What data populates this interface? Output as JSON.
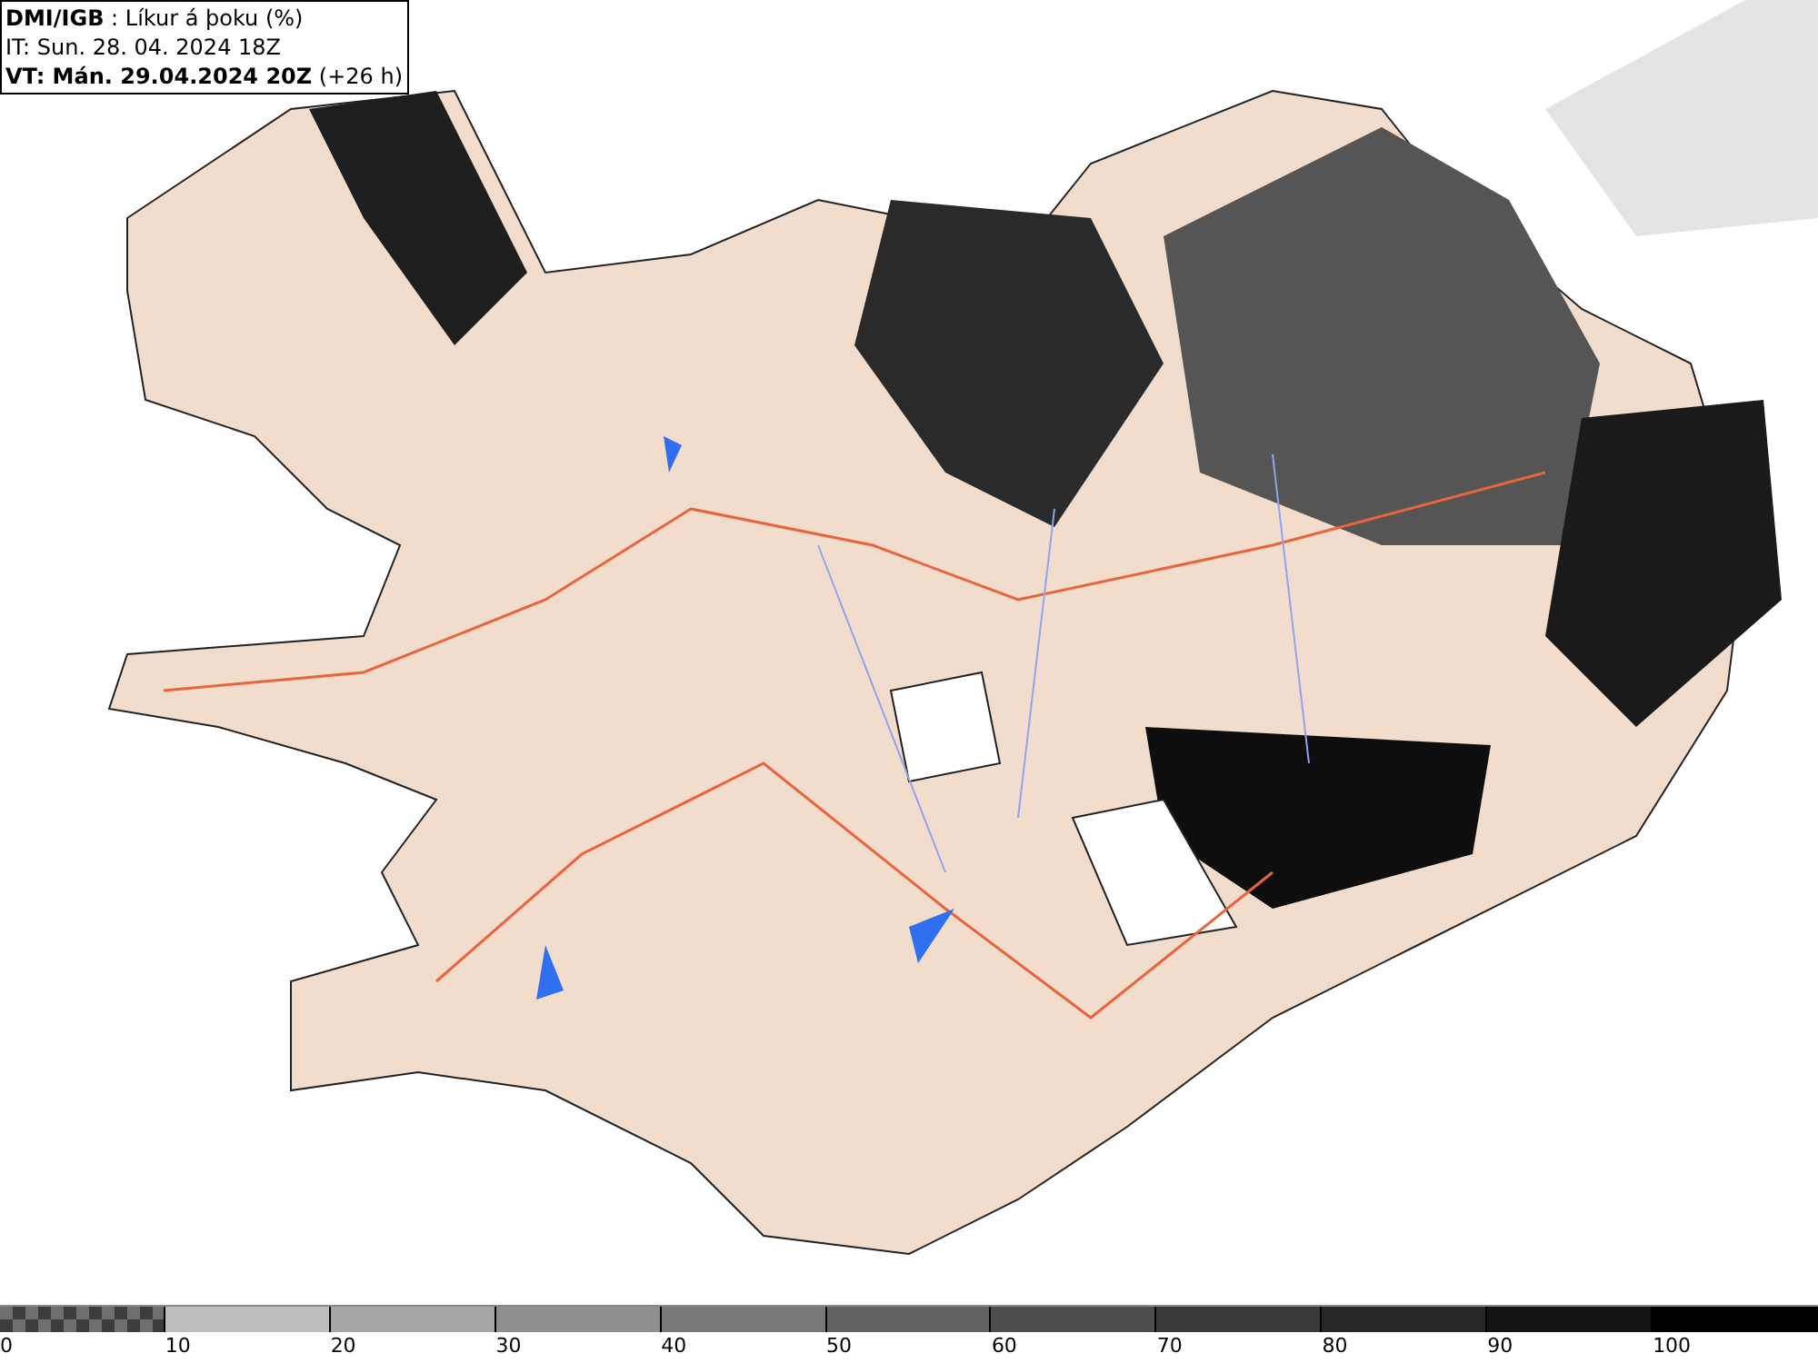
{
  "header": {
    "lines": [
      "**DMI/IGB** : Líkur á þoku (%)",
      "IT: Sun. 28. 04. 2024 18Z",
      "**VT: Mán. 29.04.2024 20Z** (+26 h)"
    ]
  },
  "legend": {
    "bins": [
      {
        "kind": "checker",
        "color": "#6e6e6e",
        "label": "0"
      },
      {
        "kind": "solid",
        "color": "#bdbdbd",
        "label": "10"
      },
      {
        "kind": "solid",
        "color": "#a6a6a6",
        "label": "20"
      },
      {
        "kind": "solid",
        "color": "#8f8f8f",
        "label": "30"
      },
      {
        "kind": "solid",
        "color": "#787878",
        "label": "40"
      },
      {
        "kind": "solid",
        "color": "#636363",
        "label": "50"
      },
      {
        "kind": "solid",
        "color": "#4e4e4e",
        "label": "60"
      },
      {
        "kind": "solid",
        "color": "#3a3a3a",
        "label": "70"
      },
      {
        "kind": "solid",
        "color": "#262626",
        "label": "80"
      },
      {
        "kind": "solid",
        "color": "#131313",
        "label": "90"
      },
      {
        "kind": "solid",
        "color": "#000000",
        "label": "100"
      }
    ]
  }
}
